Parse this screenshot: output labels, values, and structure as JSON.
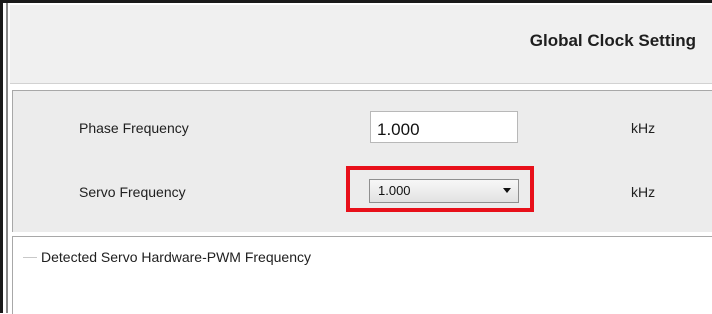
{
  "header": {
    "title": "Global Clock Setting"
  },
  "settings": {
    "phase_frequency": {
      "label": "Phase Frequency",
      "value": "1.000",
      "unit": "kHz"
    },
    "servo_frequency": {
      "label": "Servo Frequency",
      "selected": "1.000",
      "unit": "kHz"
    }
  },
  "group": {
    "title": "Detected Servo Hardware-PWM Frequency"
  },
  "colors": {
    "highlight": "#e8101a",
    "panel_bg": "#ececec",
    "header_bg": "#f0f0f0"
  },
  "icons": {
    "dropdown": "chevron-down-icon"
  }
}
